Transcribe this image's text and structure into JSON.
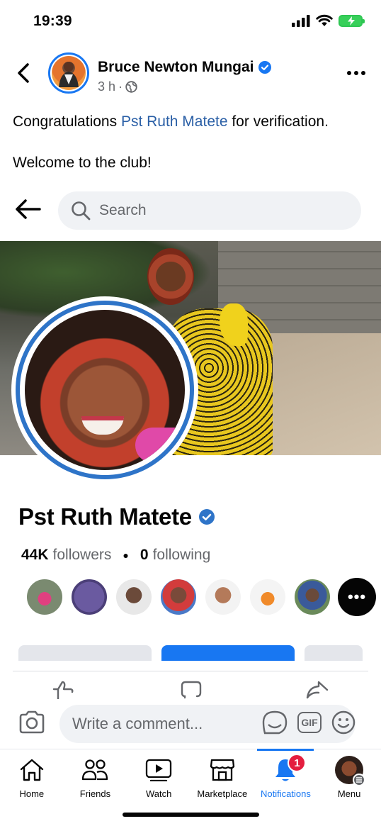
{
  "status_bar": {
    "time": "19:39"
  },
  "post": {
    "author": "Bruce Newton Mungai",
    "age": "3 h",
    "text_prefix": "Congratulations ",
    "tagged_name": "Pst Ruth Matete",
    "text_suffix": " for verification.",
    "text_line2": "Welcome to the club!"
  },
  "embedded_screenshot": {
    "search_placeholder": "Search",
    "profile_name": "Pst Ruth Matete",
    "followers_count": "44K",
    "followers_label": "followers",
    "following_count": "0",
    "following_label": "following",
    "friends_more": "•••"
  },
  "composer": {
    "placeholder": "Write a comment...",
    "gif_label": "GIF"
  },
  "tabs": [
    {
      "label": "Home",
      "icon": "home-icon"
    },
    {
      "label": "Friends",
      "icon": "friends-icon"
    },
    {
      "label": "Watch",
      "icon": "watch-icon"
    },
    {
      "label": "Marketplace",
      "icon": "marketplace-icon"
    },
    {
      "label": "Notifications",
      "icon": "bell-icon",
      "badge": "1",
      "active": true
    },
    {
      "label": "Menu",
      "icon": "profile-avatar"
    }
  ],
  "colors": {
    "accent": "#1877f2",
    "link": "#2a5fa6",
    "badge": "#e41e3f",
    "battery": "#38d05a"
  }
}
